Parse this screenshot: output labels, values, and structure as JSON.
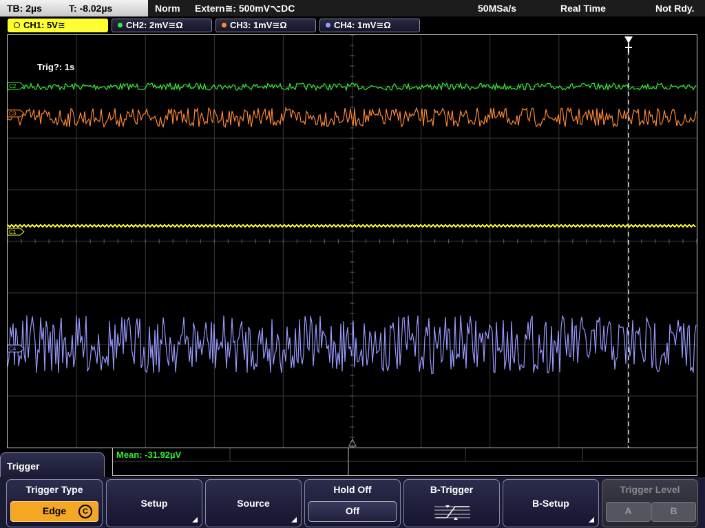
{
  "status": {
    "timebase": "TB: 2µs",
    "trigger_time": "T: -8.02µs",
    "mode": "Norm",
    "trigger_source": "Extern≅: 500mV⌥DC",
    "sample_rate": "50MSa/s",
    "acq_mode": "Real Time",
    "state": "Not Rdy."
  },
  "channels": [
    {
      "label": "CH1: 5V≅",
      "color": "#ffff33"
    },
    {
      "label": "CH2: 2mV≅Ω",
      "color": "#33ee33"
    },
    {
      "label": "CH3: 1mV≅Ω",
      "color": "#ff8833"
    },
    {
      "label": "CH4: 1mV≅Ω",
      "color": "#9999ff"
    }
  ],
  "markers": {
    "c1": "C1",
    "c2": "C2",
    "c3": "C3",
    "c4": "C4"
  },
  "trigger_info": "Trig?: 1s",
  "measurement": {
    "mean": "Mean: -31.92µV"
  },
  "menu": {
    "title": "Trigger",
    "softkeys": {
      "trigger_type": "Trigger Type",
      "trigger_type_value": "Edge",
      "trigger_type_badge": "C",
      "setup": "Setup",
      "source": "Source",
      "hold_off": "Hold Off",
      "hold_off_value": "Off",
      "b_trigger": "B-Trigger",
      "b_setup": "B-Setup",
      "trigger_level": "Trigger Level",
      "level_a": "A",
      "level_b": "B"
    }
  }
}
